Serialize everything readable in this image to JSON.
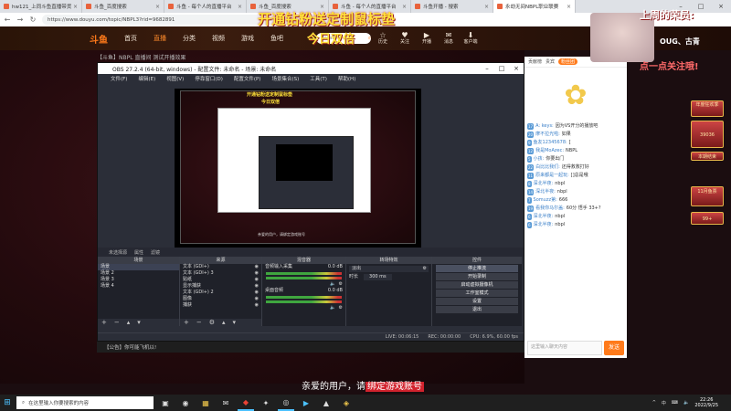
{
  "browser": {
    "tabs": [
      {
        "label": "hw121_上同斗鱼直播带货"
      },
      {
        "label": "斗鱼_百度搜索"
      },
      {
        "label": "斗鱼 - 每个人的直播平台"
      },
      {
        "label": "斗鱼_百度搜索"
      },
      {
        "label": "斗鱼 - 每个人的直播平台"
      },
      {
        "label": "斗鱼开播 - 搜索"
      },
      {
        "label": "直播后台 - 斗鱼"
      },
      {
        "label": "我的资料 - 个人中心"
      },
      {
        "label": "永劫无间NBPL职业联赛"
      }
    ],
    "url": "https://www.douyu.com/topic/NBPL3?rid=9682891"
  },
  "douyu": {
    "logo": "斗鱼",
    "nav": [
      "首页",
      "直播",
      "分类",
      "视频",
      "游戏",
      "鱼吧"
    ],
    "active_nav": "直播",
    "search_placeholder": "dota2",
    "header_icons": [
      {
        "glyph": "☆",
        "label": "历史"
      },
      {
        "glyph": "♥",
        "label": "关注"
      },
      {
        "glyph": "▶",
        "label": "开播"
      },
      {
        "glyph": "✉",
        "label": "消息"
      },
      {
        "glyph": "⬇",
        "label": "客户端"
      }
    ],
    "room_title": "【斗鱼】NBPL 直播间 测试开播效果"
  },
  "overlay": {
    "top_line1": "开通钻粉送定制鼠标垫",
    "top_line2": "今日双倍",
    "weekly": "上周的荣员:",
    "name": "OUG、古青",
    "follow": "点一点关注哦!"
  },
  "obs": {
    "title": "OBS 27.2.4 (64-bit, windows) - 配置文件: 未命名 - 场景: 未命名",
    "menu": [
      "文件(F)",
      "编辑(E)",
      "视图(V)",
      "停靠窗口(D)",
      "配置文件(P)",
      "场景集合(S)",
      "工具(T)",
      "帮助(H)"
    ],
    "scene_strip": [
      "未选择源",
      "属性",
      "滤镜"
    ],
    "docks": {
      "scenes_header": "场景",
      "scenes": [
        "场景",
        "场景 2",
        "场景 3",
        "场景 4"
      ],
      "sources_header": "来源",
      "sources": [
        "文本 (GDI+)",
        "文本 (GDI+) 3",
        "贴纸",
        "显示捕获",
        "文本 (GDI+) 2",
        "图像",
        "捕获"
      ],
      "mixer_header": "混音器",
      "mixer": [
        {
          "name": "音频输入采集",
          "level": "0.0 dB"
        },
        {
          "name": "桌面音频",
          "level": "0.0 dB"
        }
      ],
      "transition_header": "转场特效",
      "transition_type": "淡出",
      "duration_label": "时长",
      "duration": "300 ms",
      "controls_header": "控件",
      "controls": [
        "停止推流",
        "开始录制",
        "启动虚拟摄像机",
        "工作室模式",
        "设置",
        "退出"
      ]
    },
    "status": [
      "LIVE: 00:06:15",
      "REC: 00:00:00",
      "CPU: 6.9%, 60.00 fps"
    ]
  },
  "stream_bar": "【公告】你可能飞机以!",
  "subtitle": {
    "plain": "亲爱的用户，请",
    "highlight": "绑定游戏账号"
  },
  "chat": {
    "tabs": [
      "贡献榜",
      "贵宾",
      "粉丝团"
    ],
    "messages": [
      {
        "lv": "17",
        "name": "A: keys:",
        "text": "因为VS开分的播放吧"
      },
      {
        "lv": "20",
        "name": "摩不拉光啦:",
        "text": "如果"
      },
      {
        "lv": "9",
        "name": "鱼友12345678:",
        "text": "["
      },
      {
        "lv": "12",
        "name": "我是MoAzec:",
        "text": "NBPL"
      },
      {
        "lv": "5",
        "name": "小孩:",
        "text": "你要出门"
      },
      {
        "lv": "22",
        "name": "白比比我们:",
        "text": "还得救救打好"
      },
      {
        "lv": "11",
        "name": "原来都是一起玩:",
        "text": "[]总是哦"
      },
      {
        "lv": "8",
        "name": "深北半夜:",
        "text": "nbpl"
      },
      {
        "lv": "14",
        "name": "深北半夜:",
        "text": "nbpl"
      },
      {
        "lv": "7",
        "name": "Somuzz第:",
        "text": "666"
      },
      {
        "lv": "19",
        "name": "看我你马尔盖:",
        "text": "60分 悟手 33+?"
      },
      {
        "lv": "6",
        "name": "深北半夜:",
        "text": "nbpl"
      },
      {
        "lv": "6",
        "name": "深北半夜:",
        "text": "nbpl"
      }
    ],
    "input_placeholder": "这里输入聊天内容",
    "send": "发送"
  },
  "promo": {
    "cards": [
      {
        "text": "年度狂欢季"
      },
      {
        "text": "39036"
      },
      {
        "text": "本期结束"
      },
      {
        "text": "11月鱼票"
      },
      {
        "text": "99+"
      }
    ]
  },
  "taskbar": {
    "search_placeholder": "在这里输入你要搜索的内容",
    "apps": [
      "▣",
      "◉",
      "▦",
      "✉",
      "◆",
      "✦",
      "◎",
      "▶",
      "▲",
      "◈"
    ],
    "tray": [
      "^",
      "中",
      "⌨",
      "🔈"
    ],
    "time": "22:26",
    "date": "2022/9/25"
  }
}
